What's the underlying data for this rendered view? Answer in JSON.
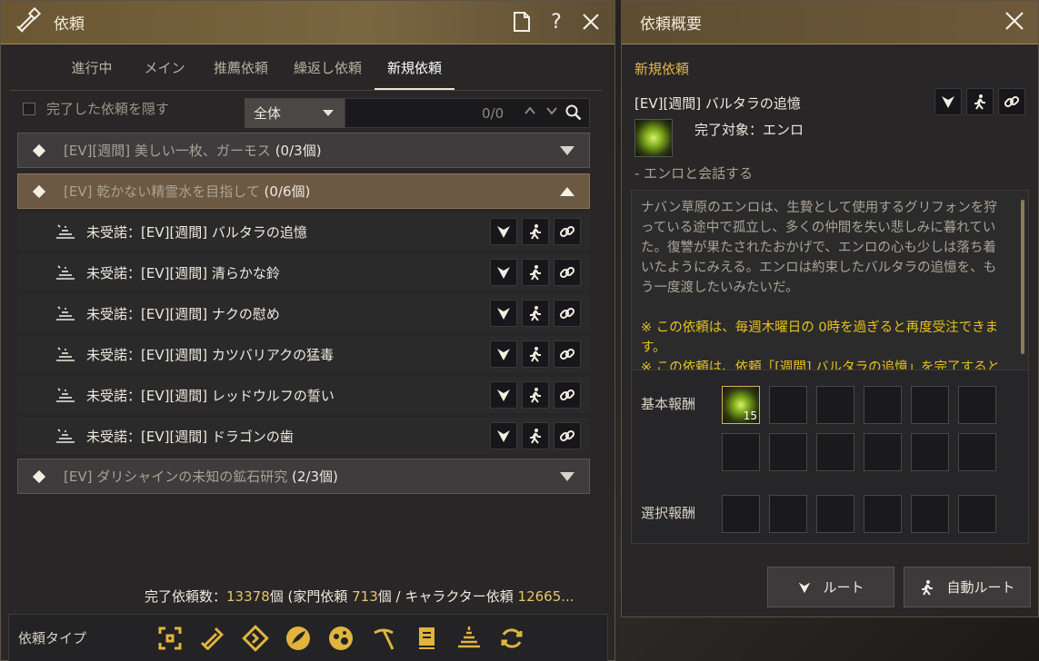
{
  "left_panel": {
    "title": "依頼",
    "tabs": [
      {
        "label": "進行中"
      },
      {
        "label": "メイン"
      },
      {
        "label": "推薦依頼"
      },
      {
        "label": "繰返し依頼"
      },
      {
        "label": "新規依頼",
        "active": true
      }
    ],
    "filter": {
      "hide_completed_label": "完了した依頼を隠す",
      "scope_selected": "全体",
      "search_count": "0/0"
    },
    "groups": [
      {
        "text": "[EV][週間] 美しい一枚、ガーモス",
        "count": "(0/3個)",
        "open": false
      },
      {
        "text": "[EV] 乾かない精霊水を目指して",
        "count": "(0/6個)",
        "open": true
      },
      {
        "text": "[EV] ダリシャインの未知の鉱石研究",
        "count": "(2/3個)",
        "open": false
      }
    ],
    "quests": [
      {
        "label": "未受諾：[EV][週間] バルタラの追憶"
      },
      {
        "label": "未受諾：[EV][週間] 清らかな鈴"
      },
      {
        "label": "未受諾：[EV][週間] ナクの慰め"
      },
      {
        "label": "未受諾：[EV][週間] カツバリアクの猛毒"
      },
      {
        "label": "未受諾：[EV][週間] レッドウルフの誓い"
      },
      {
        "label": "未受諾：[EV][週間] ドラゴンの歯"
      }
    ],
    "summary": {
      "prefix": "完了依頼数：",
      "total": "13378",
      "mid1": "個 (家門依頼 ",
      "family": "713",
      "mid2": "個 / キャラクター依頼 ",
      "character": "12665..."
    },
    "type_bar_label": "依頼タイプ",
    "type_icons": [
      "crosshair-icon",
      "scroll-quill-icon",
      "diamond-arrow-icon",
      "feather-icon",
      "planet-icon",
      "pickaxe-icon",
      "book-icon",
      "sparkle-icon",
      "refresh-icon"
    ]
  },
  "right_panel": {
    "title": "依頼概要",
    "subtitle": "新規依頼",
    "quest_title": "[EV][週間] バルタラの追憶",
    "target": "完了対象：エンロ",
    "objective": "- エンロと会話する",
    "description": "ナバン草原のエンロは、生贄として使用するグリフォンを狩っている途中で孤立し、多くの仲間を失い悲しみに暮れていた。復讐が果たされたおかげで、エンロの心も少しは落ち着いたようにみえる。エンロは約束したバルタラの追憶を、もう一度渡したいみたいだ。",
    "note1": "※ この依頼は、毎週木曜日の 0時を過ぎると再度受注できます。",
    "note2": "※ この依頼は、依頼「[週間] バルタラの追憶」を完了すると受注できます。",
    "basic_reward_label": "基本報酬",
    "choice_reward_label": "選択報酬",
    "reward_item_qty": "15",
    "route_button": "ルート",
    "auto_route_button": "自動ルート"
  },
  "colors": {
    "accent_gold": "#e3b84f",
    "note_yellow": "#e3c21e",
    "title_bar": "#6b5633"
  }
}
